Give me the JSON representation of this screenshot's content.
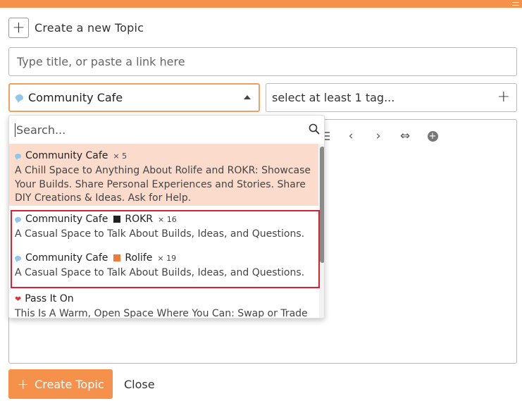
{
  "header": {
    "title": "Create a new Topic",
    "plus_glyph": "+"
  },
  "title_field": {
    "placeholder": "Type title, or paste a link here",
    "value": ""
  },
  "category": {
    "selected": "Community Cafe"
  },
  "tags": {
    "placeholder": "select at least 1 tag...",
    "plus_glyph": "+"
  },
  "editor_toolbar": {
    "prev": "‹",
    "next": "›",
    "swap": "⇔",
    "more": "+"
  },
  "dropdown": {
    "search_placeholder": "Search...",
    "options": [
      {
        "name": "Community Cafe",
        "count": "× 5",
        "tag": "",
        "tag_color": "",
        "icon": "chat-bubble-icon",
        "desc": "A Chill Space to Anything About Rolife and ROKR: Showcase Your Builds. Share Personal Experiences and Stories. Share DIY Creations & Ideas. Ask for Help."
      },
      {
        "name": "Community Cafe",
        "count": "× 16",
        "tag": "ROKR",
        "tag_color": "#222222",
        "icon": "chat-bubble-icon",
        "desc": "A Casual Space to Talk About Builds, Ideas, and Questions."
      },
      {
        "name": "Community Cafe",
        "count": "× 19",
        "tag": "Rolife",
        "tag_color": "#f07a3a",
        "icon": "chat-bubble-icon",
        "desc": "A Casual Space to Talk About Builds, Ideas, and Questions."
      },
      {
        "name": "Pass It On",
        "count": "",
        "tag": "",
        "tag_color": "",
        "icon": "heart-icon",
        "desc": "This Is A Warm, Open Space Where You Can: Swap or Trade"
      }
    ]
  },
  "footer": {
    "create_label": "Create Topic",
    "create_plus": "+",
    "close_label": "Close"
  },
  "colors": {
    "accent": "#f5914a",
    "active_option": "#fadbcc",
    "highlight": "#e02030"
  }
}
